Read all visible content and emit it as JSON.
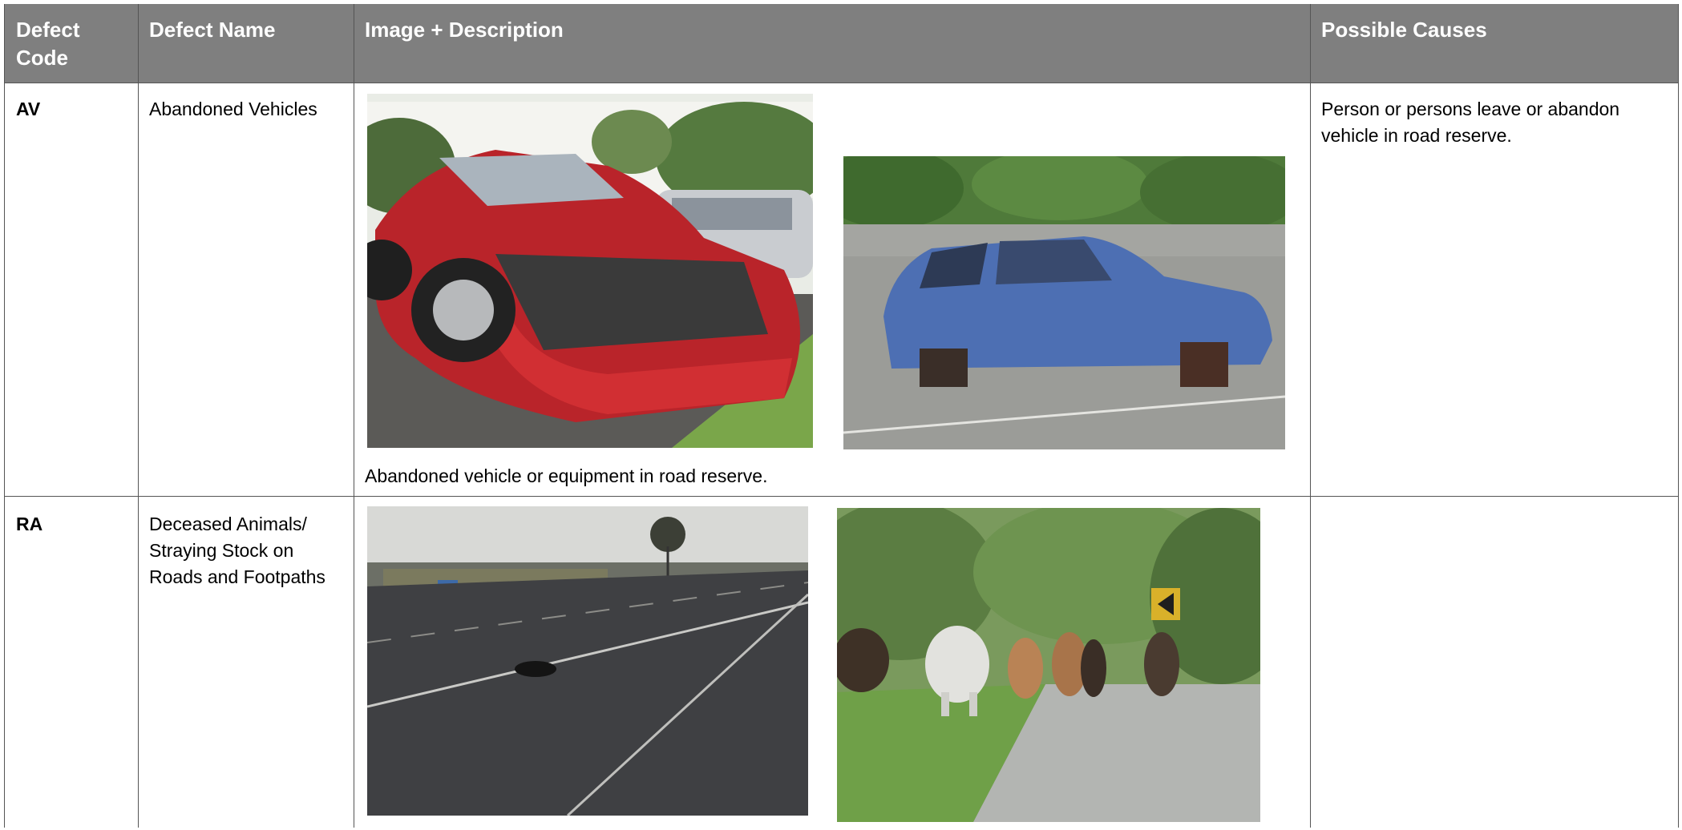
{
  "header": {
    "col_code": "Defect Code",
    "col_name": "Defect Name",
    "col_image": "Image + Description",
    "col_causes": "Possible Causes"
  },
  "rows": [
    {
      "code": "AV",
      "name": "Abandoned Vehicles",
      "description": "Abandoned vehicle or equipment in road reserve.",
      "causes": "Person or persons leave or abandon vehicle in road reserve.",
      "images": [
        "wrecked-red-car-photo",
        "stripped-blue-car-photo"
      ]
    },
    {
      "code": "RA",
      "name": "Deceased Animals/ Straying Stock on Roads and Footpaths",
      "description": "",
      "causes": "",
      "images": [
        "dead-animal-on-road-photo",
        "cattle-on-road-photo"
      ]
    }
  ]
}
